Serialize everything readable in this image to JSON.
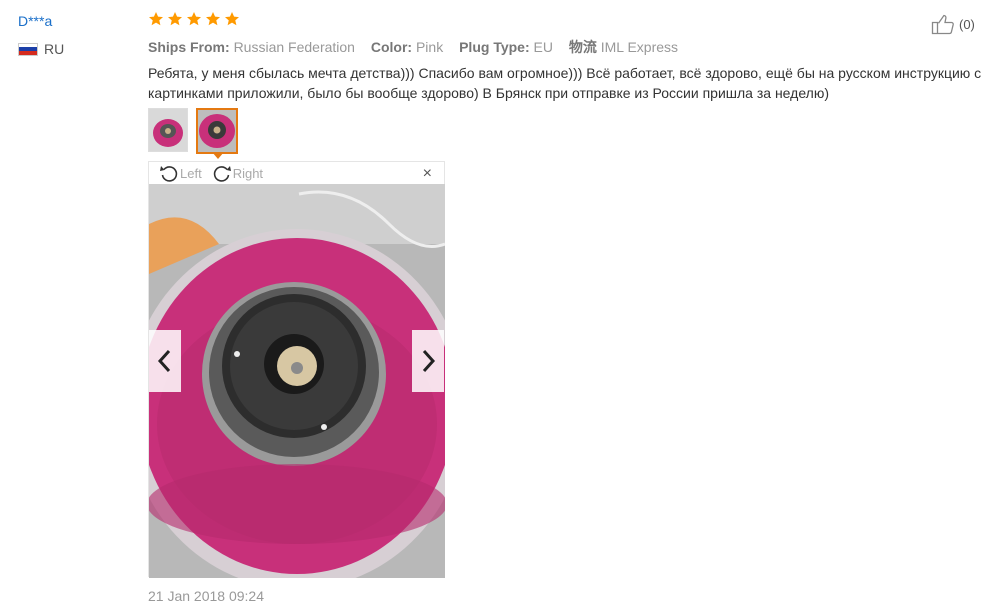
{
  "user": {
    "name": "D***a",
    "country": "RU"
  },
  "rating": {
    "stars": 5
  },
  "meta": {
    "ships_from_label": "Ships From:",
    "ships_from_value": "Russian Federation",
    "color_label": "Color:",
    "color_value": "Pink",
    "plug_label": "Plug Type:",
    "plug_value": "EU",
    "logistics_label": "物流",
    "logistics_value": "IML Express"
  },
  "helpful": {
    "count": "(0)"
  },
  "review": {
    "text": "Ребята, у меня сбылась мечта детства))) Спасибо вам огромное))) Всё работает, всё здорово, ещё бы на русском инструкцию с картинками приложили, было бы вообще здорово) В Брянск при отправке из России пришла за неделю)"
  },
  "viewer": {
    "rotate_left": "Left",
    "rotate_right": "Right",
    "close": "×"
  },
  "date": "21 Jan 2018 09:24",
  "colors": {
    "accent": "#e47911",
    "link": "#1a6fc9",
    "star": "#ff9a00",
    "pink": "#c8307a"
  }
}
